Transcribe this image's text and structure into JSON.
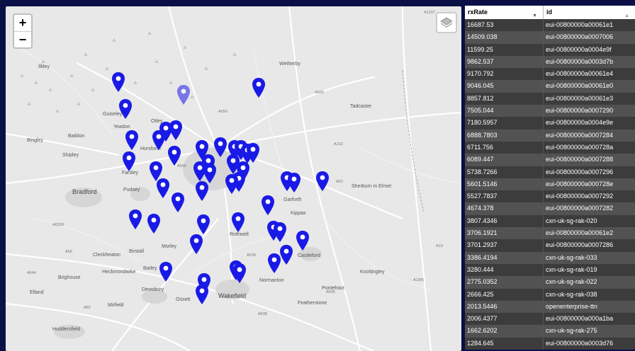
{
  "map": {
    "zoom_in_label": "+",
    "zoom_out_label": "−",
    "marker_color": "#1a1ae6",
    "places": [
      "Ilkley",
      "Guiseley",
      "Yeadon",
      "Baildon",
      "Bingley",
      "Shipley",
      "Bradford",
      "Pudsey",
      "Horsforth",
      "Farsley",
      "Morley",
      "Birstall",
      "Batley",
      "Dewsbury",
      "Cleckheaton",
      "Heckmondwike",
      "Brighouse",
      "Elland",
      "Mirfield",
      "Huddersfield",
      "Ossett",
      "Wakefield",
      "Normanton",
      "Castleford",
      "Knottingley",
      "Pontefract",
      "Featherstone",
      "Rothwell",
      "Garforth",
      "Kippax",
      "Tadcaster",
      "Wetherby",
      "Sherburn in Elmet",
      "Otley"
    ],
    "roads": [
      "A1237",
      "A659",
      "A162",
      "A660",
      "A6038",
      "A650",
      "A58",
      "A644",
      "A62",
      "A638",
      "A639",
      "A645",
      "A19",
      "A1(M)",
      "A63"
    ]
  },
  "table": {
    "columns": [
      "rxRate",
      "id"
    ],
    "rows": [
      {
        "rxRate": "16687.53",
        "id": "eui-00800000a00061e1"
      },
      {
        "rxRate": "14509.038",
        "id": "eui-00800000a0007006"
      },
      {
        "rxRate": "11599.25",
        "id": "eui-00800000a0004e9f"
      },
      {
        "rxRate": "9862.537",
        "id": "eui-00800000a0003d7b"
      },
      {
        "rxRate": "9170.792",
        "id": "eui-00800000a00061e4"
      },
      {
        "rxRate": "9046.045",
        "id": "eui-00800000a00061e0"
      },
      {
        "rxRate": "8857.812",
        "id": "eui-00800000a00061e3"
      },
      {
        "rxRate": "7505.044",
        "id": "eui-00800000a0007290"
      },
      {
        "rxRate": "7180.5957",
        "id": "eui-00800000a0004e9e"
      },
      {
        "rxRate": "6888.7803",
        "id": "eui-00800000a0007284"
      },
      {
        "rxRate": "6711.756",
        "id": "eui-00800000a000728a"
      },
      {
        "rxRate": "6089.447",
        "id": "eui-00800000a0007288"
      },
      {
        "rxRate": "5738.7266",
        "id": "eui-00800000a0007296"
      },
      {
        "rxRate": "5601.5146",
        "id": "eui-00800000a000728e"
      },
      {
        "rxRate": "5527.7837",
        "id": "eui-00800000a0007292"
      },
      {
        "rxRate": "4674.378",
        "id": "eui-00800000a0007282"
      },
      {
        "rxRate": "3807.4346",
        "id": "cxn-uk-sg-rak-020"
      },
      {
        "rxRate": "3706.1921",
        "id": "eui-00800000a00061e2"
      },
      {
        "rxRate": "3701.2937",
        "id": "eui-00800000a0007286"
      },
      {
        "rxRate": "3386.4194",
        "id": "cxn-uk-sg-rak-033"
      },
      {
        "rxRate": "3280.444",
        "id": "cxn-uk-sg-rak-019"
      },
      {
        "rxRate": "2775.0352",
        "id": "cxn-uk-sg-rak-022"
      },
      {
        "rxRate": "2666.425",
        "id": "cxn-uk-sg-rak-038"
      },
      {
        "rxRate": "2013.5446",
        "id": "openenterprise-ttn"
      },
      {
        "rxRate": "2006.4377",
        "id": "eui-00800000a000a1ba"
      },
      {
        "rxRate": "1662.6202",
        "id": "cxn-uk-sg-rak-275"
      },
      {
        "rxRate": "1284.645",
        "id": "eui-00800000a0003d76"
      }
    ]
  }
}
